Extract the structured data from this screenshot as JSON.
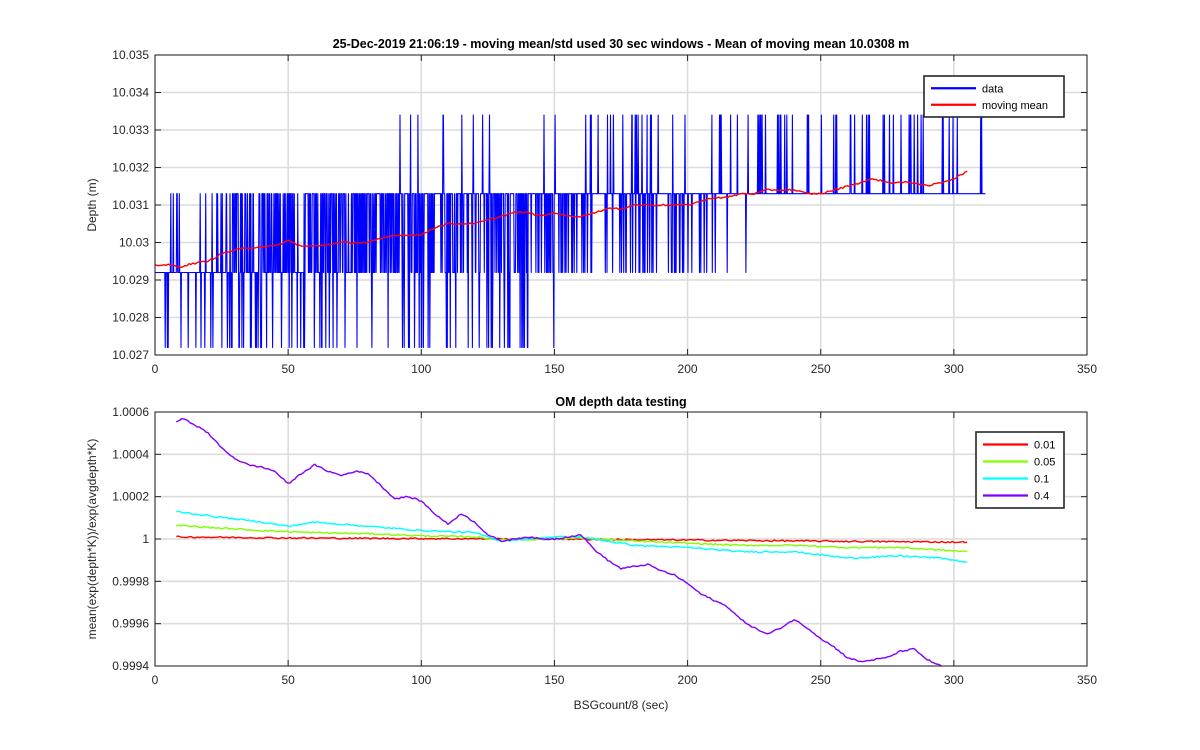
{
  "chart_data": [
    {
      "type": "line",
      "title": "25-Dec-2019 21:06:19 - moving mean/std used 30 sec windows - Mean of moving mean 10.0308 m",
      "xlabel": "",
      "ylabel": "Depth (m)",
      "xlim": [
        0,
        350
      ],
      "ylim": [
        10.027,
        10.035
      ],
      "xticks": [
        "0",
        "50",
        "100",
        "150",
        "200",
        "250",
        "300",
        "350"
      ],
      "yticks": [
        "10.027",
        "10.028",
        "10.029",
        "10.03",
        "10.031",
        "10.032",
        "10.033",
        "10.034",
        "10.035"
      ],
      "grid": true,
      "legend": "top-right",
      "series": [
        {
          "name": "data",
          "color": "#0000ff",
          "kind": "quantized-noise",
          "x_range": [
            0,
            312
          ],
          "levels": [
            10.0272,
            10.0292,
            10.0313,
            10.0334
          ],
          "x": [
            0,
            15,
            30,
            50,
            70,
            90,
            110,
            130,
            150,
            175,
            200,
            225,
            250,
            275,
            300,
            312
          ],
          "y": [
            10.0294,
            10.0294,
            10.03,
            10.0302,
            10.0303,
            10.0306,
            10.0308,
            10.0309,
            10.0308,
            10.031,
            10.0311,
            10.0313,
            10.0315,
            10.0317,
            10.032,
            10.032
          ]
        },
        {
          "name": "moving mean",
          "color": "#ff0000",
          "x": [
            0,
            5,
            9,
            12,
            15,
            20,
            25,
            30,
            35,
            40,
            45,
            50,
            55,
            60,
            65,
            70,
            75,
            80,
            85,
            90,
            95,
            100,
            105,
            110,
            115,
            120,
            125,
            130,
            135,
            140,
            145,
            150,
            155,
            160,
            165,
            170,
            175,
            180,
            185,
            190,
            195,
            200,
            205,
            210,
            215,
            220,
            225,
            230,
            235,
            240,
            245,
            250,
            255,
            260,
            265,
            270,
            275,
            280,
            285,
            290,
            295,
            300,
            305
          ],
          "y": [
            10.0294,
            10.0294,
            10.02935,
            10.0294,
            10.02945,
            10.0295,
            10.0297,
            10.0298,
            10.02985,
            10.0299,
            10.0299,
            10.03005,
            10.0299,
            10.0299,
            10.02995,
            10.03,
            10.03,
            10.03,
            10.0301,
            10.0302,
            10.0302,
            10.0302,
            10.0304,
            10.0305,
            10.0305,
            10.0305,
            10.0306,
            10.0307,
            10.0308,
            10.0308,
            10.0307,
            10.0308,
            10.0307,
            10.0307,
            10.0308,
            10.0309,
            10.0309,
            10.031,
            10.031,
            10.031,
            10.031,
            10.031,
            10.0311,
            10.0312,
            10.0312,
            10.0313,
            10.0313,
            10.0314,
            10.0314,
            10.0314,
            10.0313,
            10.0313,
            10.0314,
            10.0315,
            10.0316,
            10.0317,
            10.0316,
            10.0316,
            10.0316,
            10.0315,
            10.0316,
            10.0317,
            10.0319
          ]
        }
      ]
    },
    {
      "type": "line",
      "title": "OM depth data testing",
      "xlabel": "BSGcount/8 (sec)",
      "ylabel": "mean(exp(depth*K))/exp(avgdepth*K)",
      "xlim": [
        0,
        350
      ],
      "ylim": [
        0.9994,
        1.0006
      ],
      "xticks": [
        "0",
        "50",
        "100",
        "150",
        "200",
        "250",
        "300",
        "350"
      ],
      "yticks": [
        "0.9994",
        "0.9996",
        "0.9998",
        "1",
        "1.0002",
        "1.0004",
        "1.0006"
      ],
      "grid": true,
      "legend": "top-right",
      "series": [
        {
          "name": "0.01",
          "color": "#ff0000",
          "x": [
            8,
            50,
            100,
            150,
            200,
            250,
            305
          ],
          "y": [
            1.00001,
            1.000005,
            1.000002,
            1.0,
            0.999995,
            0.99999,
            0.999985
          ]
        },
        {
          "name": "0.05",
          "color": "#80ff00",
          "x": [
            8,
            20,
            40,
            60,
            80,
            100,
            120,
            130,
            150,
            160,
            180,
            200,
            220,
            240,
            260,
            280,
            305
          ],
          "y": [
            1.000065,
            1.000055,
            1.00004,
            1.00003,
            1.000025,
            1.000015,
            1.00001,
            0.999995,
            1.0,
            1.000005,
            0.99999,
            0.99998,
            0.99997,
            0.99997,
            0.99996,
            0.99996,
            0.99994
          ]
        },
        {
          "name": "0.1",
          "color": "#00ffff",
          "x": [
            8,
            20,
            40,
            50,
            60,
            80,
            100,
            120,
            130,
            150,
            160,
            180,
            200,
            220,
            240,
            260,
            280,
            295,
            305
          ],
          "y": [
            1.00013,
            1.00011,
            1.00008,
            1.00006,
            1.00008,
            1.00006,
            1.00004,
            1.00003,
            0.99999,
            1.00001,
            1.00001,
            0.99997,
            0.99996,
            0.99994,
            0.99994,
            0.99991,
            0.99992,
            0.99991,
            0.99989
          ]
        },
        {
          "name": "0.4",
          "color": "#8000ff",
          "x": [
            8,
            10,
            15,
            20,
            25,
            30,
            35,
            40,
            45,
            50,
            55,
            60,
            65,
            70,
            75,
            80,
            85,
            90,
            95,
            100,
            105,
            110,
            115,
            120,
            125,
            130,
            135,
            140,
            145,
            150,
            155,
            160,
            165,
            170,
            175,
            180,
            185,
            190,
            195,
            200,
            205,
            210,
            215,
            220,
            225,
            230,
            235,
            240,
            245,
            250,
            255,
            260,
            265,
            270,
            275,
            280,
            285,
            290,
            295,
            300,
            305
          ],
          "y": [
            1.00055,
            1.00057,
            1.00054,
            1.0005,
            1.00043,
            1.00038,
            1.00035,
            1.00034,
            1.00032,
            1.00026,
            1.00031,
            1.00035,
            1.00032,
            1.0003,
            1.00032,
            1.00031,
            1.00025,
            1.00019,
            1.0002,
            1.00018,
            1.00012,
            1.00007,
            1.00012,
            1.00008,
            1.00002,
            0.99999,
            1.0,
            1.00001,
            1.0,
            1.0,
            1.00001,
            1.00002,
            0.99995,
            0.9999,
            0.99986,
            0.99987,
            0.99988,
            0.99985,
            0.99983,
            0.99979,
            0.99974,
            0.99971,
            0.99968,
            0.99962,
            0.99958,
            0.99955,
            0.99958,
            0.99962,
            0.99958,
            0.99953,
            0.99949,
            0.99944,
            0.99942,
            0.99943,
            0.99944,
            0.99947,
            0.99948,
            0.99943,
            0.9994,
            0.99936,
            0.99932
          ]
        }
      ]
    }
  ]
}
